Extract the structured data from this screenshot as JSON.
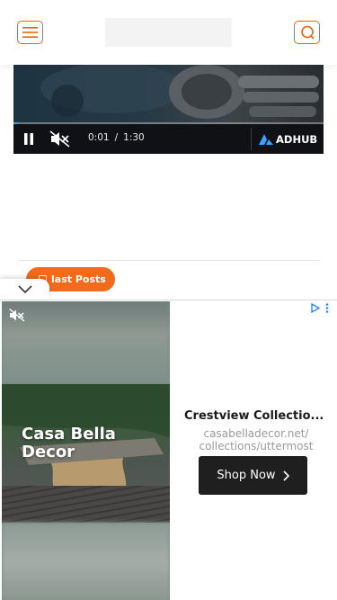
{
  "header": {
    "menu_icon": "hamburger-icon",
    "search_icon": "search-icon",
    "accent_color": "#e8650a"
  },
  "video": {
    "current_time": "0:01",
    "separator": "/",
    "duration": "1:30",
    "progress_fraction": 0.011,
    "brand": "ADHUB",
    "icons": [
      "pause-icon",
      "muted-speaker-icon",
      "adhub-logo-icon"
    ]
  },
  "section": {
    "latest_posts_label": "last Posts",
    "latest_posts_color": "#f26b1d"
  },
  "ad": {
    "brand_line1": "Casa Bella",
    "brand_line2": "Decor",
    "title": "Crestview Collectio...",
    "url_line1": "casabelladecor.net/",
    "url_line2": "collections/uttermost",
    "cta_label": "Shop Now",
    "icons": [
      "muted-speaker-icon",
      "adchoices-icon",
      "more-options-icon",
      "chevron-right-icon",
      "chevron-down-icon"
    ]
  }
}
